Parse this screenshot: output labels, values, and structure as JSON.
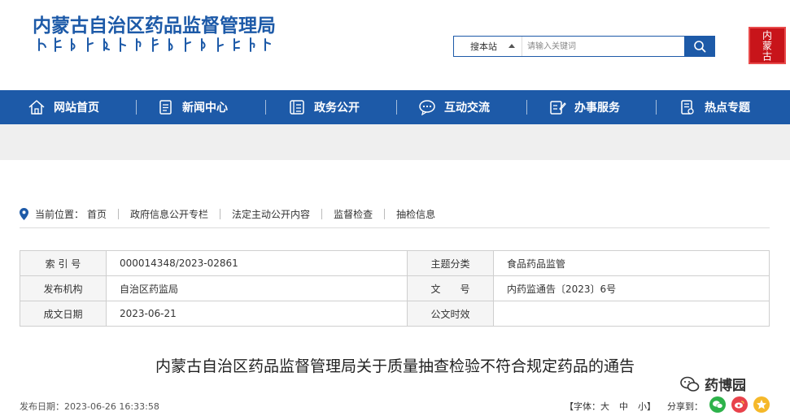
{
  "header": {
    "logo_cn": "内蒙古自治区药品监督管理局",
    "search_scope": "搜本站",
    "search_placeholder": "请输入关键词",
    "seal_text": "内蒙古"
  },
  "nav": {
    "items": [
      {
        "label": "网站首页",
        "icon": "home-icon"
      },
      {
        "label": "新闻中心",
        "icon": "news-icon"
      },
      {
        "label": "政务公开",
        "icon": "gov-icon"
      },
      {
        "label": "互动交流",
        "icon": "chat-icon"
      },
      {
        "label": "办事服务",
        "icon": "service-icon"
      },
      {
        "label": "热点专题",
        "icon": "topic-icon"
      }
    ]
  },
  "breadcrumb": {
    "prefix": "当前位置：",
    "items": [
      "首页",
      "政府信息公开专栏",
      "法定主动公开内容",
      "监督检查",
      "抽检信息"
    ]
  },
  "info": {
    "rows": [
      {
        "k1": "索 引 号",
        "v1": "000014348/2023-02861",
        "k2": "主题分类",
        "v2": "食品药品监管"
      },
      {
        "k1": "发布机构",
        "v1": "自治区药监局",
        "k2": "文　　号",
        "v2": "内药监通告〔2023〕6号"
      },
      {
        "k1": "成文日期",
        "v1": "2023-06-21",
        "k2": "公文时效",
        "v2": ""
      }
    ]
  },
  "article": {
    "title": "内蒙古自治区药品监督管理局关于质量抽查检验不符合规定药品的通告",
    "publish_label": "发布日期：",
    "publish_date": "2023-06-26 16:33:58",
    "font_label": "【字体：",
    "font_large": "大",
    "font_medium": "中",
    "font_small": "小】",
    "share_label": "分享到："
  },
  "watermark": {
    "text": "药博园"
  },
  "colors": {
    "brand_blue": "#1d5aa8",
    "seal_red": "#c8141a",
    "band_grey": "#efefef"
  }
}
